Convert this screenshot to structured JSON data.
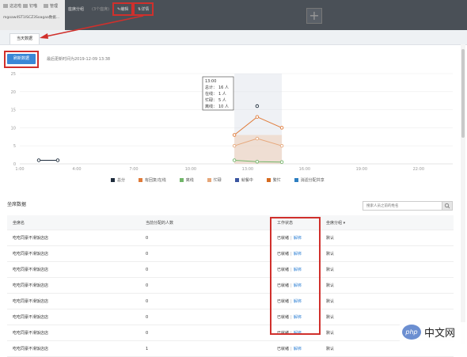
{
  "topbar": {
    "left_items": [
      "这这啦",
      "钉喵",
      "管理"
    ],
    "left_url": "mgoaw4ST1ISCZ3Soagaa数据...",
    "group_label": "座席分组",
    "group_count": "(3个座席)",
    "edit_label": "编辑",
    "detail_label": "详情",
    "add_label": "+"
  },
  "tab": {
    "label": "当天数据"
  },
  "toolbar": {
    "refresh_label": "刷新数据",
    "updated_text": "最后更新时间为2019-12-09 13:38"
  },
  "chart_data": {
    "type": "line",
    "x_ticks": [
      "1:00",
      "4:00",
      "7:00",
      "10:00",
      "13:00",
      "16:00",
      "19:00",
      "22:00"
    ],
    "y_ticks": [
      "0",
      "5",
      "10",
      "15",
      "20",
      "25"
    ],
    "ylim": [
      0,
      25
    ],
    "series": [
      {
        "name": "总分",
        "color": "#1f2d3d",
        "points": [
          [
            2.0,
            1
          ],
          [
            3.0,
            1
          ],
          [
            13.5,
            16
          ]
        ]
      },
      {
        "name": "有回复/在线",
        "color": "#e07b39",
        "points": [
          [
            12.3,
            8
          ],
          [
            13.5,
            13
          ],
          [
            14.8,
            10
          ]
        ]
      },
      {
        "name": "离线",
        "color": "#72b66a",
        "points": [
          [
            12.3,
            1
          ],
          [
            13.5,
            0.6
          ],
          [
            14.8,
            0.5
          ]
        ]
      },
      {
        "name": "忙碌",
        "color": "#e6a77a",
        "points": [
          [
            12.3,
            5
          ],
          [
            13.5,
            7
          ],
          [
            14.8,
            5
          ]
        ]
      },
      {
        "name": "就餐中",
        "color": "#3b55a0",
        "points": []
      },
      {
        "name": "繁忙",
        "color": "#d66b20",
        "points": []
      },
      {
        "name": "消滤分配共享",
        "color": "#2d7fc1",
        "points": []
      }
    ],
    "tooltip": {
      "title": "13:00",
      "lines": [
        {
          "label": "总计：",
          "value": "16 人",
          "color": "#1f2d3d"
        },
        {
          "label": "在线：",
          "value": "1 人",
          "color": "#e07b39"
        },
        {
          "label": "忙碌：",
          "value": "5 人",
          "color": "#72b66a"
        },
        {
          "label": "离线：",
          "value": "10 人",
          "color": "#e6a77a"
        }
      ]
    },
    "highlight_x": [
      12.3,
      14.8
    ]
  },
  "legend": [
    {
      "label": "总分",
      "color": "#1f2d3d"
    },
    {
      "label": "有回复/在线",
      "color": "#e07b39"
    },
    {
      "label": "离线",
      "color": "#72b66a"
    },
    {
      "label": "忙碌",
      "color": "#e6a77a"
    },
    {
      "label": "就餐中",
      "color": "#3b55a0"
    },
    {
      "label": "繁忙",
      "color": "#d66b20"
    },
    {
      "label": "消滤分配共享",
      "color": "#2d7fc1"
    }
  ],
  "section": {
    "title": "坐席数据",
    "search_placeholder": "搜索人员之前的姓名"
  },
  "table": {
    "columns": [
      "坐席名",
      "当前分配的人数",
      "工作状态",
      "坐席分组 ▾"
    ],
    "rows": [
      {
        "name": "吃吃同豪不滑饭店店",
        "count": "0",
        "status": "已就绪",
        "action": "解绑",
        "group": "默认"
      },
      {
        "name": "吃吃同豪不滑饭店店",
        "count": "0",
        "status": "已就绪",
        "action": "解绑",
        "group": "默认"
      },
      {
        "name": "吃吃同豪不滑饭店店",
        "count": "0",
        "status": "已就绪",
        "action": "解绑",
        "group": "默认"
      },
      {
        "name": "吃吃同豪不滑饭店店",
        "count": "0",
        "status": "已就绪",
        "action": "解绑",
        "group": "默认"
      },
      {
        "name": "吃吃同豪不滑饭店店",
        "count": "0",
        "status": "已就绪",
        "action": "解绑",
        "group": "默认"
      },
      {
        "name": "吃吃同豪不滑饭店店",
        "count": "0",
        "status": "已就绪",
        "action": "解绑",
        "group": "默认"
      },
      {
        "name": "吃吃同豪不滑饭店店",
        "count": "0",
        "status": "已就绪",
        "action": "解绑",
        "group": "默认"
      },
      {
        "name": "吃吃同豪不滑饭店店",
        "count": "1",
        "status": "已就绪",
        "action": "解绑",
        "group": "默认"
      }
    ]
  },
  "watermark": {
    "logo": "php",
    "text": "中文网"
  },
  "colors": {
    "accent": "#3a87d6",
    "annotation": "#d0302c",
    "topbar": "#4a5057"
  }
}
